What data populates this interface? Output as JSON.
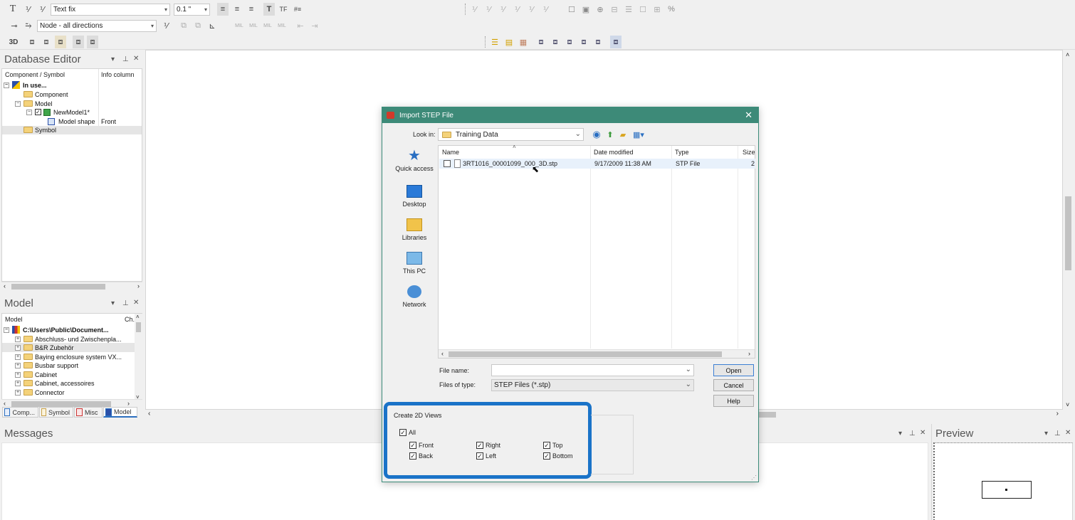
{
  "toolbar": {
    "text_fix": "Text fix",
    "size": "0.1 \"",
    "node": "Node - all directions",
    "label_3d": "3D",
    "mil_labels": [
      "MIL",
      "MIL",
      "MIL",
      "MIL"
    ]
  },
  "database_editor": {
    "title": "Database Editor",
    "col_component": "Component / Symbol",
    "col_info": "Info column",
    "rows": [
      {
        "label": "In use..."
      },
      {
        "label": "Component"
      },
      {
        "label": "Model"
      },
      {
        "label": "NewModel1*"
      },
      {
        "label": "Model shape",
        "info": "Front"
      },
      {
        "label": "Symbol"
      }
    ]
  },
  "model_panel": {
    "title": "Model",
    "col_model": "Model",
    "col_ch": "Ch.",
    "rows": [
      "C:\\Users\\Public\\Document...",
      "Abschluss- und Zwischenpla...",
      "B&R Zubehör",
      "Baying enclosure system VX...",
      "Busbar support",
      "Cabinet",
      "Cabinet, accessoires",
      "Connector"
    ],
    "tabs": [
      "Comp...",
      "Symbol",
      "Misc",
      "Model"
    ]
  },
  "messages": {
    "title": "Messages"
  },
  "preview": {
    "title": "Preview"
  },
  "dialog": {
    "title": "Import STEP File",
    "look_in_label": "Look in:",
    "look_in_value": "Training Data",
    "places": [
      "Quick access",
      "Desktop",
      "Libraries",
      "This PC",
      "Network"
    ],
    "columns": [
      "Name",
      "Date modified",
      "Type",
      "Size"
    ],
    "files": [
      {
        "name": "3RT1016_00001099_000_3D.stp",
        "date": "9/17/2009 11:38 AM",
        "type": "STP File",
        "size": "2"
      }
    ],
    "file_name_label": "File name:",
    "file_name_value": "",
    "files_of_type_label": "Files of type:",
    "files_of_type_value": "STEP Files (*.stp)",
    "open_label": "Open",
    "cancel_label": "Cancel",
    "help_label": "Help",
    "views_group_title": "Create 2D Views",
    "views": {
      "all": {
        "label": "All",
        "checked": true
      },
      "front": {
        "label": "Front",
        "checked": true
      },
      "back": {
        "label": "Back",
        "checked": true
      },
      "right": {
        "label": "Right",
        "checked": true
      },
      "left": {
        "label": "Left",
        "checked": true
      },
      "top": {
        "label": "Top",
        "checked": true
      },
      "bottom": {
        "label": "Bottom",
        "checked": true
      }
    },
    "highlight_color": "#1a73c8"
  },
  "colors": {
    "title_bar": "#3d8a78",
    "accent": "#1a73c8"
  }
}
